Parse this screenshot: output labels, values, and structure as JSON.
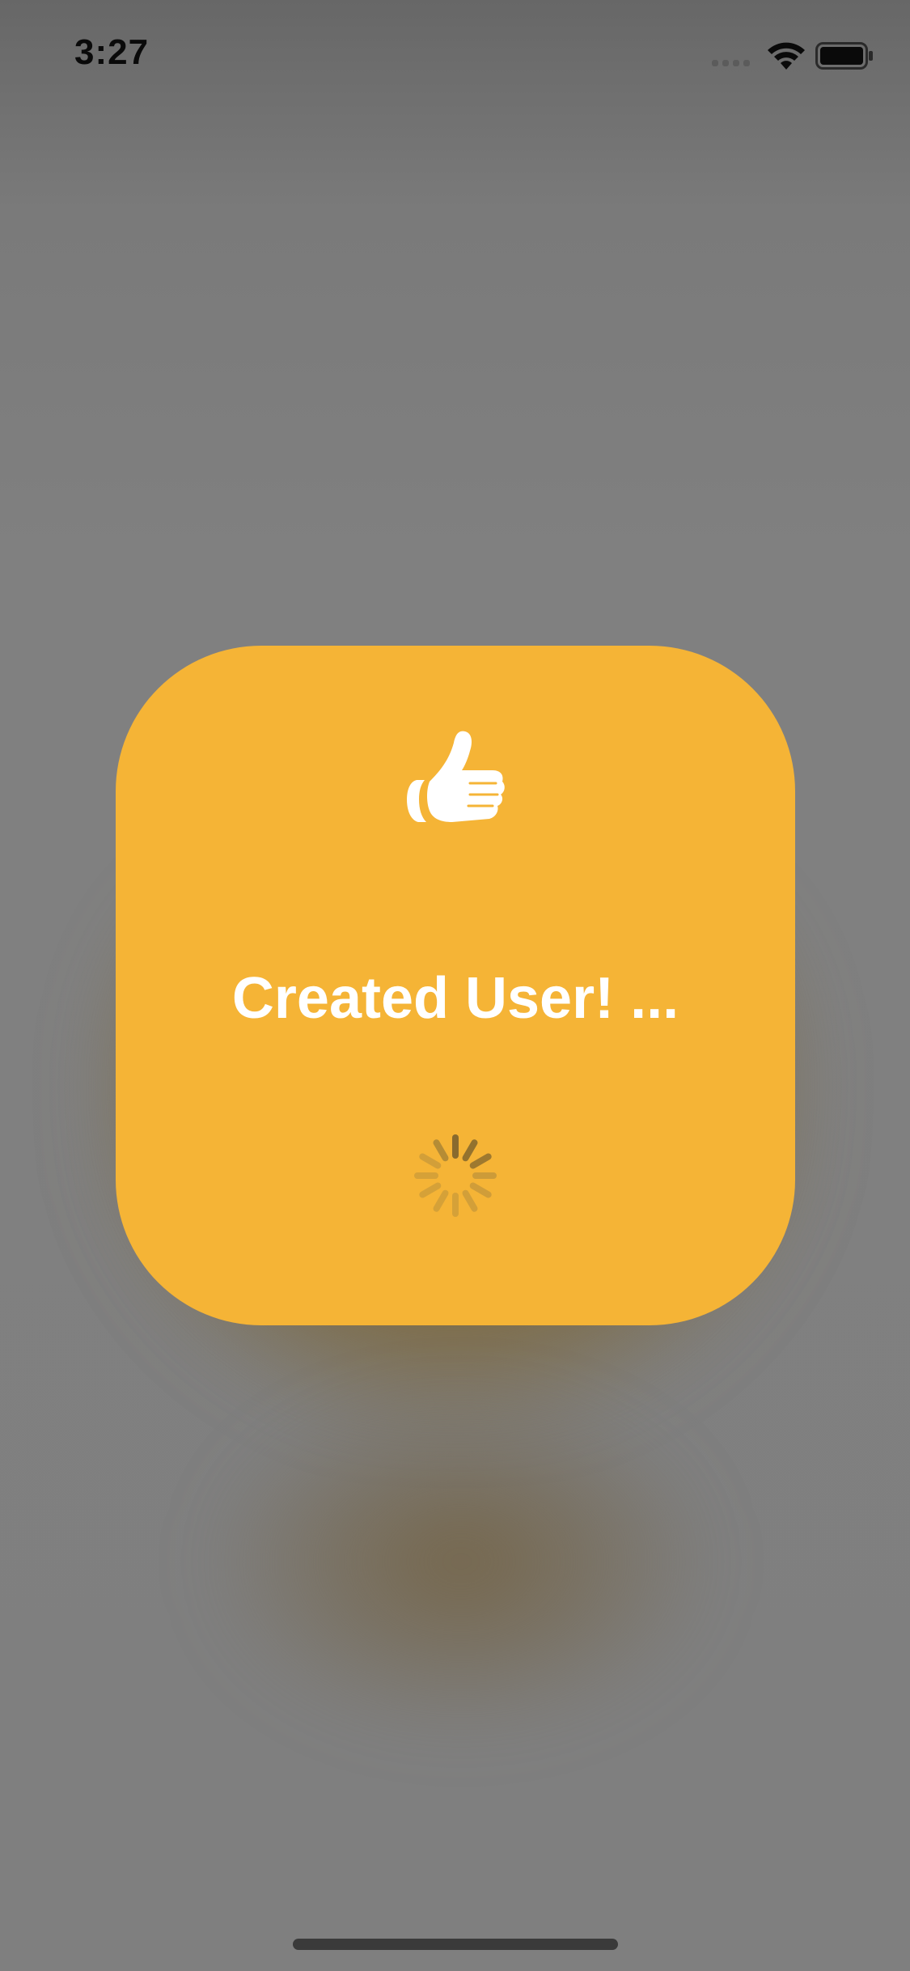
{
  "status_bar": {
    "time": "3:27",
    "icons": [
      "cellular-signal-icon",
      "wifi-icon",
      "battery-icon"
    ]
  },
  "hud": {
    "icon": "thumbs-up-icon",
    "message": "Created User! ...",
    "background_color": "#f5b436",
    "text_color": "#ffffff",
    "activity": "spinner"
  },
  "background": {
    "state": "dimmed-overlay"
  }
}
